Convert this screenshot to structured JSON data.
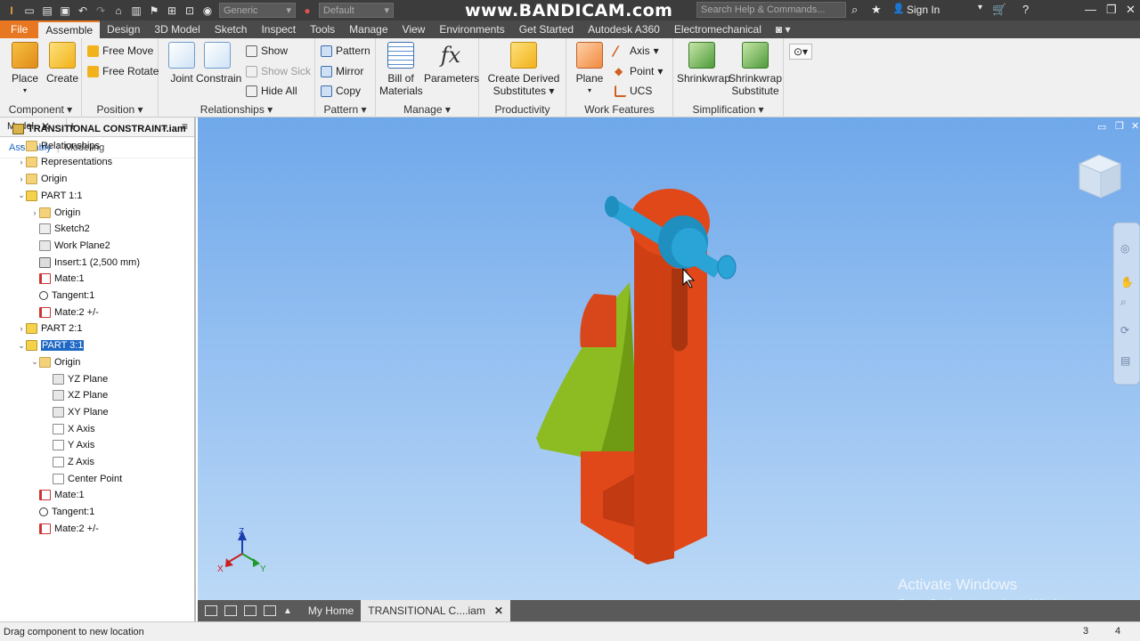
{
  "titlebar": {
    "appearance_dropdown": "Generic",
    "material_dropdown": "Default",
    "watermark": "www.BANDICAM.com",
    "search_placeholder": "Search Help & Commands...",
    "signin": "Sign In"
  },
  "tabs": [
    "File",
    "Assemble",
    "Design",
    "3D Model",
    "Sketch",
    "Inspect",
    "Tools",
    "Manage",
    "View",
    "Environments",
    "Get Started",
    "Autodesk A360",
    "Electromechanical"
  ],
  "ribbon": {
    "component": {
      "label": "Component",
      "place": "Place",
      "create": "Create"
    },
    "position": {
      "label": "Position",
      "free_move": "Free Move",
      "free_rotate": "Free Rotate"
    },
    "relationships": {
      "label": "Relationships",
      "joint": "Joint",
      "constrain": "Constrain",
      "show": "Show",
      "show_sick": "Show Sick",
      "hide_all": "Hide All"
    },
    "pattern": {
      "label": "Pattern",
      "pattern": "Pattern",
      "mirror": "Mirror",
      "copy": "Copy"
    },
    "manage": {
      "label": "Manage",
      "bom_line1": "Bill of",
      "bom_line2": "Materials",
      "parameters": "Parameters"
    },
    "productivity": {
      "label": "Productivity",
      "cds_line1": "Create Derived",
      "cds_line2": "Substitutes"
    },
    "work_features": {
      "label": "Work Features",
      "plane": "Plane",
      "axis": "Axis",
      "point": "Point",
      "ucs": "UCS"
    },
    "simplification": {
      "label": "Simplification",
      "shrinkwrap": "Shrinkwrap",
      "sws_line1": "Shrinkwrap",
      "sws_line2": "Substitute"
    }
  },
  "browser": {
    "title": "Model",
    "subtab_assembly": "Assembly",
    "subtab_modeling": "Modeling",
    "tree": [
      {
        "label": "TRANSITIONAL CONSTRAINT.iam",
        "icon": "asm",
        "depth": 0,
        "exp": "",
        "bold": true
      },
      {
        "label": "Relationships",
        "icon": "folder",
        "depth": 1,
        "exp": ">"
      },
      {
        "label": "Representations",
        "icon": "folder",
        "depth": 1,
        "exp": ">"
      },
      {
        "label": "Origin",
        "icon": "folder",
        "depth": 1,
        "exp": ">"
      },
      {
        "label": "PART 1:1",
        "icon": "part",
        "depth": 1,
        "exp": "v"
      },
      {
        "label": "Origin",
        "icon": "folder",
        "depth": 2,
        "exp": ">"
      },
      {
        "label": "Sketch2",
        "icon": "sketch",
        "depth": 2,
        "exp": ""
      },
      {
        "label": "Work Plane2",
        "icon": "plane",
        "depth": 2,
        "exp": ""
      },
      {
        "label": "Insert:1 (2,500 mm)",
        "icon": "insert",
        "depth": 2,
        "exp": ""
      },
      {
        "label": "Mate:1",
        "icon": "mate",
        "depth": 2,
        "exp": ""
      },
      {
        "label": "Tangent:1",
        "icon": "tangent",
        "depth": 2,
        "exp": ""
      },
      {
        "label": "Mate:2 +/-",
        "icon": "mate",
        "depth": 2,
        "exp": ""
      },
      {
        "label": "PART 2:1",
        "icon": "part",
        "depth": 1,
        "exp": ">"
      },
      {
        "label": "PART 3:1",
        "icon": "part",
        "depth": 1,
        "exp": "v",
        "selected": true
      },
      {
        "label": "Origin",
        "icon": "folder",
        "depth": 2,
        "exp": "v"
      },
      {
        "label": "YZ Plane",
        "icon": "plane",
        "depth": 3,
        "exp": ""
      },
      {
        "label": "XZ Plane",
        "icon": "plane",
        "depth": 3,
        "exp": ""
      },
      {
        "label": "XY Plane",
        "icon": "plane",
        "depth": 3,
        "exp": ""
      },
      {
        "label": "X Axis",
        "icon": "axis",
        "depth": 3,
        "exp": ""
      },
      {
        "label": "Y Axis",
        "icon": "axis",
        "depth": 3,
        "exp": ""
      },
      {
        "label": "Z Axis",
        "icon": "axis",
        "depth": 3,
        "exp": ""
      },
      {
        "label": "Center Point",
        "icon": "axis",
        "depth": 3,
        "exp": ""
      },
      {
        "label": "Mate:1",
        "icon": "mate",
        "depth": 2,
        "exp": ""
      },
      {
        "label": "Tangent:1",
        "icon": "tangent",
        "depth": 2,
        "exp": ""
      },
      {
        "label": "Mate:2 +/-",
        "icon": "mate",
        "depth": 2,
        "exp": ""
      }
    ]
  },
  "viewport": {
    "axis_z": "Z",
    "axis_x": "X",
    "axis_y": "Y",
    "activate_title": "Activate Windows",
    "activate_sub": "Go to Settings to activate Windows.",
    "colors": {
      "part_orange": "#e0481a",
      "pin_blue": "#2aa3d6",
      "segment_green": "#8dbb22"
    }
  },
  "doctabs": {
    "home": "My Home",
    "active": "TRANSITIONAL C....iam"
  },
  "status": {
    "message": "Drag component to new location",
    "n1": "3",
    "n2": "4"
  }
}
